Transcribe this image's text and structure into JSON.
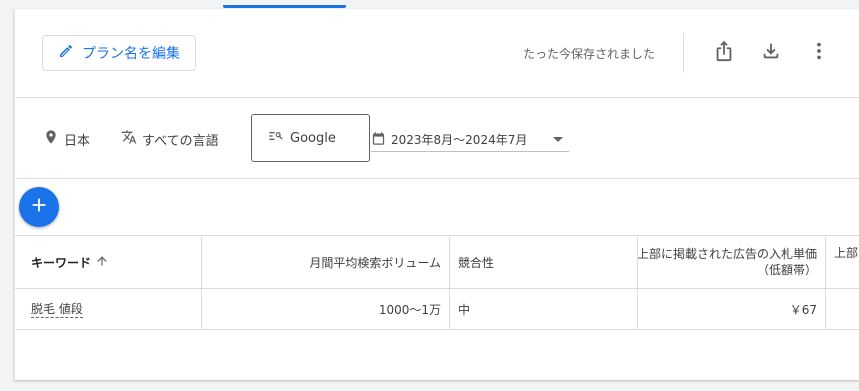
{
  "top_bar": {
    "edit_plan_label": "プラン名を編集",
    "save_status": "たった今保存されました"
  },
  "filters": {
    "location": "日本",
    "language": "すべての言語",
    "network": "Google",
    "date_range": "2023年8月～2024年7月"
  },
  "table": {
    "headers": {
      "keyword": "キーワード",
      "avg_monthly_searches": "月間平均検索ボリューム",
      "competition": "競合性",
      "top_bid_low_line1": "上部に掲載された広告の入札単価",
      "top_bid_low_line2": "（低額帯）",
      "top_bid_high_partial": "上部に掲載された広告の入札単価（高額帯）"
    },
    "rows": [
      {
        "keyword": "脱毛 値段",
        "avg_monthly_searches": "1000～1万",
        "competition": "中",
        "top_bid_low": "￥67",
        "top_bid_high": ""
      }
    ]
  },
  "colors": {
    "accent": "#1a73e8",
    "text": "#3c4043",
    "muted": "#5f6368",
    "divider": "#dadce0"
  },
  "icons": {
    "edit": "pencil-icon",
    "share": "share-icon",
    "download": "download-icon",
    "more": "more-vert-icon",
    "location": "location-pin-icon",
    "language": "translate-icon",
    "network": "search-network-icon",
    "calendar": "calendar-icon",
    "add": "plus-icon",
    "sort": "arrow-up-icon"
  }
}
